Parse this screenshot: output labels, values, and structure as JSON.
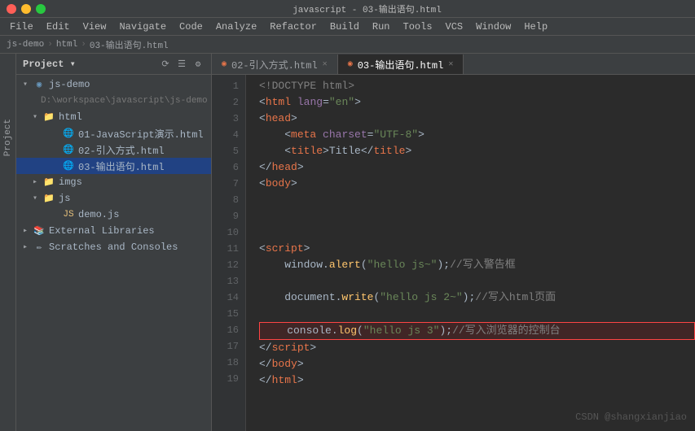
{
  "titlebar": {
    "title": "javascript - 03-输出语句.html"
  },
  "menubar": {
    "items": [
      "File",
      "Edit",
      "View",
      "Navigate",
      "Code",
      "Analyze",
      "Refactor",
      "Build",
      "Run",
      "Tools",
      "VCS",
      "Window",
      "Help"
    ]
  },
  "breadcrumb": {
    "items": [
      "js-demo",
      "html",
      "03-输出语句.html"
    ]
  },
  "sidebar": {
    "title": "Project",
    "root": "js-demo",
    "root_path": "D:\\workspace\\javascript\\js-demo",
    "items": [
      {
        "id": "js-demo",
        "label": "js-demo",
        "type": "project",
        "indent": 1,
        "expanded": true
      },
      {
        "id": "html",
        "label": "html",
        "type": "folder",
        "indent": 2,
        "expanded": true
      },
      {
        "id": "01-js-html",
        "label": "01-JavaScript演示.html",
        "type": "html",
        "indent": 3
      },
      {
        "id": "02-html",
        "label": "02-引入方式.html",
        "type": "html",
        "indent": 3
      },
      {
        "id": "03-html",
        "label": "03-输出语句.html",
        "type": "html",
        "indent": 3,
        "selected": true
      },
      {
        "id": "imgs",
        "label": "imgs",
        "type": "folder",
        "indent": 2,
        "expanded": false
      },
      {
        "id": "js",
        "label": "js",
        "type": "folder",
        "indent": 2,
        "expanded": true
      },
      {
        "id": "demo-js",
        "label": "demo.js",
        "type": "js",
        "indent": 3
      },
      {
        "id": "ext-lib",
        "label": "External Libraries",
        "type": "folder",
        "indent": 1,
        "expanded": false
      },
      {
        "id": "scratches",
        "label": "Scratches and Consoles",
        "type": "folder",
        "indent": 1,
        "expanded": false
      }
    ]
  },
  "tabs": [
    {
      "id": "tab-02",
      "label": "02-引入方式.html",
      "active": false,
      "type": "html"
    },
    {
      "id": "tab-03",
      "label": "03-输出语句.html",
      "active": true,
      "type": "html"
    }
  ],
  "editor": {
    "filename": "03-输出语句.html",
    "lines": [
      {
        "num": 1,
        "tokens": [
          {
            "text": "<!DOCTYPE html>",
            "class": "doctype"
          }
        ]
      },
      {
        "num": 2,
        "tokens": [
          {
            "text": "<",
            "class": "plain"
          },
          {
            "text": "html",
            "class": "tag"
          },
          {
            "text": " ",
            "class": "plain"
          },
          {
            "text": "lang",
            "class": "attr"
          },
          {
            "text": "=",
            "class": "plain"
          },
          {
            "text": "\"en\"",
            "class": "str"
          },
          {
            "text": ">",
            "class": "plain"
          }
        ]
      },
      {
        "num": 3,
        "tokens": [
          {
            "text": "<",
            "class": "plain"
          },
          {
            "text": "head",
            "class": "tag"
          },
          {
            "text": ">",
            "class": "plain"
          }
        ]
      },
      {
        "num": 4,
        "tokens": [
          {
            "text": "    <",
            "class": "plain"
          },
          {
            "text": "meta",
            "class": "tag"
          },
          {
            "text": " ",
            "class": "plain"
          },
          {
            "text": "charset",
            "class": "attr"
          },
          {
            "text": "=",
            "class": "plain"
          },
          {
            "text": "\"UTF-8\"",
            "class": "str"
          },
          {
            "text": ">",
            "class": "plain"
          }
        ]
      },
      {
        "num": 5,
        "tokens": [
          {
            "text": "    <",
            "class": "plain"
          },
          {
            "text": "title",
            "class": "tag"
          },
          {
            "text": ">Title</",
            "class": "plain"
          },
          {
            "text": "title",
            "class": "tag"
          },
          {
            "text": ">",
            "class": "plain"
          }
        ]
      },
      {
        "num": 6,
        "tokens": [
          {
            "text": "</",
            "class": "plain"
          },
          {
            "text": "head",
            "class": "tag"
          },
          {
            "text": ">",
            "class": "plain"
          }
        ]
      },
      {
        "num": 7,
        "tokens": [
          {
            "text": "<",
            "class": "plain"
          },
          {
            "text": "body",
            "class": "tag"
          },
          {
            "text": ">",
            "class": "plain"
          }
        ]
      },
      {
        "num": 8,
        "tokens": []
      },
      {
        "num": 9,
        "tokens": []
      },
      {
        "num": 10,
        "tokens": []
      },
      {
        "num": 11,
        "tokens": [
          {
            "text": "<",
            "class": "plain"
          },
          {
            "text": "script",
            "class": "tag"
          },
          {
            "text": ">",
            "class": "plain"
          }
        ]
      },
      {
        "num": 12,
        "tokens": [
          {
            "text": "    window.",
            "class": "plain"
          },
          {
            "text": "alert",
            "class": "fn"
          },
          {
            "text": "(",
            "class": "plain"
          },
          {
            "text": "\"hello js~\"",
            "class": "str"
          },
          {
            "text": ");",
            "class": "plain"
          },
          {
            "text": "//写入警告框",
            "class": "comment"
          }
        ]
      },
      {
        "num": 13,
        "tokens": []
      },
      {
        "num": 14,
        "tokens": [
          {
            "text": "    document.",
            "class": "plain"
          },
          {
            "text": "write",
            "class": "fn"
          },
          {
            "text": "(",
            "class": "plain"
          },
          {
            "text": "\"hello js 2~\"",
            "class": "str"
          },
          {
            "text": ");",
            "class": "plain"
          },
          {
            "text": "//写入html页面",
            "class": "comment"
          }
        ]
      },
      {
        "num": 15,
        "tokens": []
      },
      {
        "num": 16,
        "tokens": [
          {
            "text": "    console.",
            "class": "plain"
          },
          {
            "text": "log",
            "class": "fn"
          },
          {
            "text": "(",
            "class": "plain"
          },
          {
            "text": "\"hello js 3\"",
            "class": "str"
          },
          {
            "text": ");",
            "class": "plain"
          },
          {
            "text": "//写入浏览器的控制台",
            "class": "comment"
          }
        ],
        "highlight": true
      },
      {
        "num": 17,
        "tokens": [
          {
            "text": "</",
            "class": "plain"
          },
          {
            "text": "script",
            "class": "tag"
          },
          {
            "text": ">",
            "class": "plain"
          }
        ]
      },
      {
        "num": 18,
        "tokens": [
          {
            "text": "</",
            "class": "plain"
          },
          {
            "text": "body",
            "class": "tag"
          },
          {
            "text": ">",
            "class": "plain"
          }
        ]
      },
      {
        "num": 19,
        "tokens": [
          {
            "text": "</",
            "class": "plain"
          },
          {
            "text": "html",
            "class": "tag"
          },
          {
            "text": ">",
            "class": "plain"
          }
        ]
      }
    ]
  },
  "watermark": {
    "text": "CSDN @shangxianjiao"
  }
}
